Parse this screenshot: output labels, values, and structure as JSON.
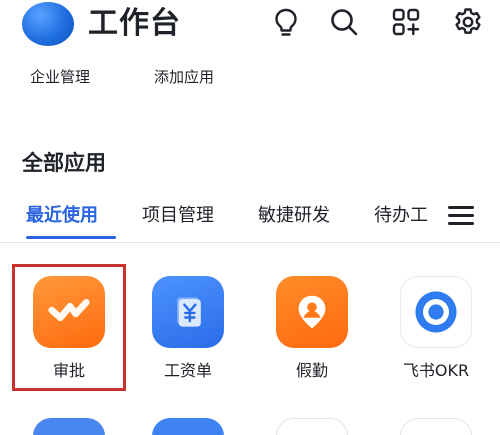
{
  "header": {
    "title": "工作台",
    "icons": [
      "lightbulb-icon",
      "search-icon",
      "grid-add-icon",
      "settings-icon"
    ]
  },
  "quick_links": [
    "企业管理",
    "添加应用"
  ],
  "section_title": "全部应用",
  "tabs": [
    {
      "label": "最近使用",
      "active": true
    },
    {
      "label": "项目管理",
      "active": false
    },
    {
      "label": "敏捷研发",
      "active": false
    },
    {
      "label": "待办工",
      "active": false
    }
  ],
  "apps": [
    {
      "label": "审批",
      "icon": "approval-icon",
      "color": "#ff7a1a",
      "highlighted": true
    },
    {
      "label": "工资单",
      "icon": "payslip-icon",
      "color": "#2f7bf0"
    },
    {
      "label": "假勤",
      "icon": "attendance-icon",
      "color": "#ff7a1a"
    },
    {
      "label": "飞书OKR",
      "icon": "okr-icon",
      "color": "#2f7bf0"
    }
  ],
  "colors": {
    "accent": "#2a64e0",
    "highlight": "#c9312f",
    "text": "#1f2329"
  }
}
